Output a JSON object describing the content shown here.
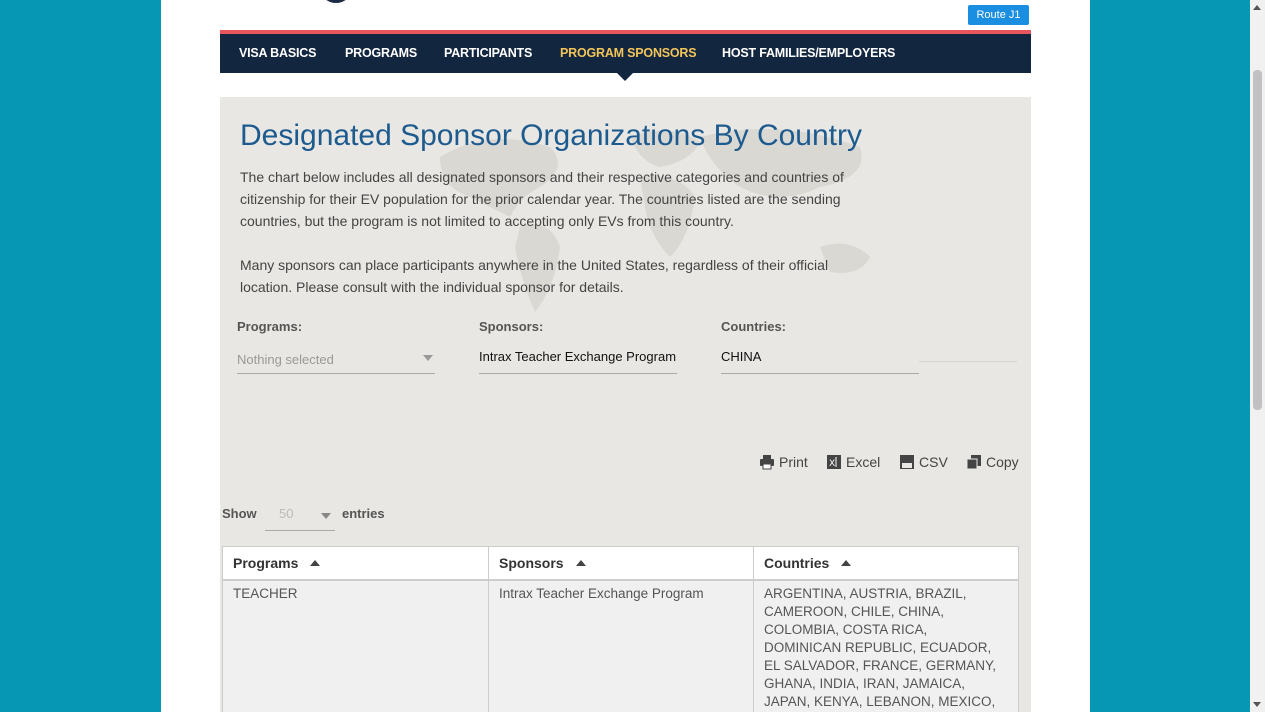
{
  "header": {
    "route_button": "Route J1"
  },
  "nav": {
    "items": [
      {
        "label": "VISA BASICS"
      },
      {
        "label": "PROGRAMS"
      },
      {
        "label": "PARTICIPANTS"
      },
      {
        "label": "PROGRAM SPONSORS",
        "active": true
      },
      {
        "label": "HOST FAMILIES/EMPLOYERS"
      }
    ]
  },
  "main": {
    "title": "Designated Sponsor Organizations By Country",
    "description_1": "The chart below includes all designated sponsors and their respective categories and countries of citizenship for their EV population for the prior calendar year. The countries listed are the sending countries, but the program is not limited to accepting only EVs from this country.",
    "description_2": "Many sponsors can place participants anywhere in the United States, regardless of their official location. Please consult with the individual sponsor for details."
  },
  "filters": {
    "programs_label": "Programs:",
    "programs_value": "Nothing selected",
    "sponsors_label": "Sponsors:",
    "sponsors_value": "Intrax Teacher Exchange Program",
    "countries_label": "Countries:",
    "countries_value": "CHINA"
  },
  "export": {
    "print": "Print",
    "excel": "Excel",
    "csv": "CSV",
    "copy": "Copy"
  },
  "length": {
    "show": "Show",
    "value": "50",
    "entries": "entries"
  },
  "table": {
    "headers": [
      "Programs",
      "Sponsors",
      "Countries"
    ],
    "rows": [
      {
        "program": "TEACHER",
        "sponsor": "Intrax Teacher Exchange Program",
        "countries": "ARGENTINA, AUSTRIA, BRAZIL, CAMEROON, CHILE, CHINA, COLOMBIA, COSTA RICA, DOMINICAN REPUBLIC, ECUADOR, EL SALVADOR, FRANCE, GERMANY, GHANA, INDIA, IRAN, JAMAICA, JAPAN, KENYA, LEBANON, MEXICO, NICARAGUA,"
      }
    ]
  },
  "colors": {
    "background": "#0597b4",
    "nav": "#12263f",
    "nav_accent": "#e8555c",
    "nav_active": "#f2c45a",
    "title": "#1d5a8e",
    "route_button": "#1a8ee0"
  }
}
